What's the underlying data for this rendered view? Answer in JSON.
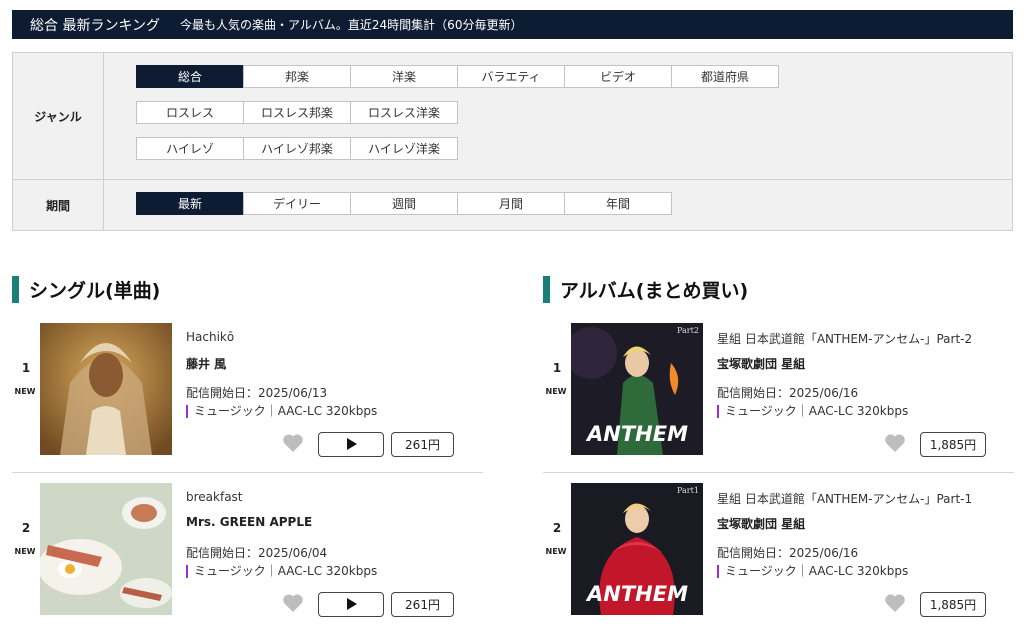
{
  "header": {
    "title": "総合 最新ランキング",
    "subtitle": "今最も人気の楽曲・アルバム。直近24時間集計（60分毎更新）"
  },
  "filter": {
    "genre_label": "ジャンル",
    "genre_rows": [
      [
        "総合",
        "邦楽",
        "洋楽",
        "バラエティ",
        "ビデオ",
        "都道府県"
      ],
      [
        "ロスレス",
        "ロスレス邦楽",
        "ロスレス洋楽"
      ],
      [
        "ハイレゾ",
        "ハイレゾ邦楽",
        "ハイレゾ洋楽"
      ]
    ],
    "period_label": "期間",
    "period_options": [
      "最新",
      "デイリー",
      "週間",
      "月間",
      "年間"
    ],
    "active_genre": "総合",
    "active_period": "最新"
  },
  "singles": {
    "heading": "シングル(単曲)",
    "items": [
      {
        "rank": "1",
        "badge": "NEW",
        "title": "Hachikō",
        "artist": "藤井 風",
        "date": "配信開始日：2025/06/13",
        "meta": "ミュージック｜AAC-LC 320kbps",
        "price": "261円"
      },
      {
        "rank": "2",
        "badge": "NEW",
        "title": "breakfast",
        "artist": "Mrs. GREEN APPLE",
        "date": "配信開始日：2025/06/04",
        "meta": "ミュージック｜AAC-LC 320kbps",
        "price": "261円"
      }
    ]
  },
  "albums": {
    "heading": "アルバム(まとめ買い)",
    "items": [
      {
        "rank": "1",
        "badge": "NEW",
        "title": "星組 日本武道館「ANTHEM-アンセム-」Part-2",
        "artist": "宝塚歌劇団 星組",
        "date": "配信開始日：2025/06/16",
        "meta": "ミュージック｜AAC-LC 320kbps",
        "price": "1,885円",
        "jacket_text": "ANTHEM",
        "jacket_part": "Part2"
      },
      {
        "rank": "2",
        "badge": "NEW",
        "title": "星組 日本武道館「ANTHEM-アンセム-」Part-1",
        "artist": "宝塚歌劇団 星組",
        "date": "配信開始日：2025/06/16",
        "meta": "ミュージック｜AAC-LC 320kbps",
        "price": "1,885円",
        "jacket_text": "ANTHEM",
        "jacket_part": "Part1"
      }
    ]
  },
  "icons": {
    "favorite": "heart-icon",
    "play": "play-icon"
  },
  "colors": {
    "navy": "#0e1c33",
    "teal_accent": "#1a7f76",
    "meta_accent": "#a62bd6"
  }
}
